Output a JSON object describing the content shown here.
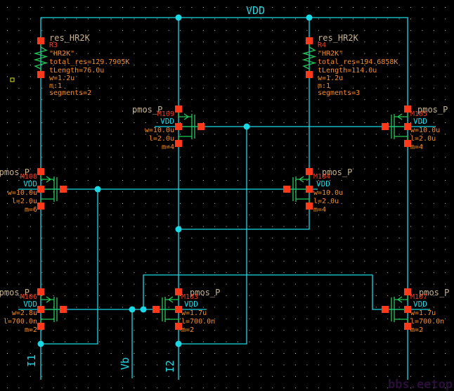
{
  "colors": {
    "background": "#000000",
    "wire": "#19d9e6",
    "device": "#1fcc5a",
    "pin": "#ff3a1a",
    "property": "#ff8c1a",
    "cell_name": "#c8b48c",
    "watermark": "#2a0f3a"
  },
  "nets": {
    "vdd": "VDD",
    "i1": "I1",
    "vb": "Vb",
    "i2": "I2"
  },
  "resistors": [
    {
      "cell": "res_HR2K",
      "inst": "R3",
      "model": "\"HR2K\"",
      "total_res": "total_res=129.7905K",
      "tlength": "tLength=76.0u",
      "w": "w=1.2u",
      "m": "m:1",
      "segments": "segments=2"
    },
    {
      "cell": "res_HR2K",
      "inst": "R4",
      "model": "\"HR2K\"",
      "total_res": "total_res=194.6858K",
      "tlength": "tLength=114.0u",
      "w": "w=1.2u",
      "m": "m:1",
      "segments": "segments=3"
    }
  ],
  "transistors": [
    {
      "cell": "pmos_P",
      "inst": "M109",
      "bulk": "VDD",
      "w": "w=10.0u",
      "l": "l=2.0u",
      "m": "m=4"
    },
    {
      "cell": "pmos_P",
      "inst": "M105",
      "bulk": "VDD",
      "w": "w=10.0u",
      "l": "l=2.0u",
      "m": "m=4"
    },
    {
      "cell": "pmos_P",
      "inst": "M108",
      "bulk": "VDD",
      "w": "w=10.0u",
      "l": "l=2.0u",
      "m": "m=6"
    },
    {
      "cell": "pmos_P",
      "inst": "M104",
      "bulk": "VDD",
      "w": "w=10.0u",
      "l": "l=2.0u",
      "m": "m=4"
    },
    {
      "cell": "pmos_P",
      "inst": "M106",
      "bulk": "VDD",
      "w": "w=2.8u",
      "l": "l=700.0n",
      "m": "m=2"
    },
    {
      "cell": "pmos_P",
      "inst": "M103",
      "bulk": "VDD",
      "w": "w=1.7u",
      "l": "l=700.0n",
      "m": "m=2"
    },
    {
      "cell": "pmos_P",
      "inst": "M107",
      "bulk": "VDD",
      "w": "w=1.7u",
      "l": "l=700.0n",
      "m": "m=2"
    }
  ],
  "watermark": "bbs.eetop.cn"
}
